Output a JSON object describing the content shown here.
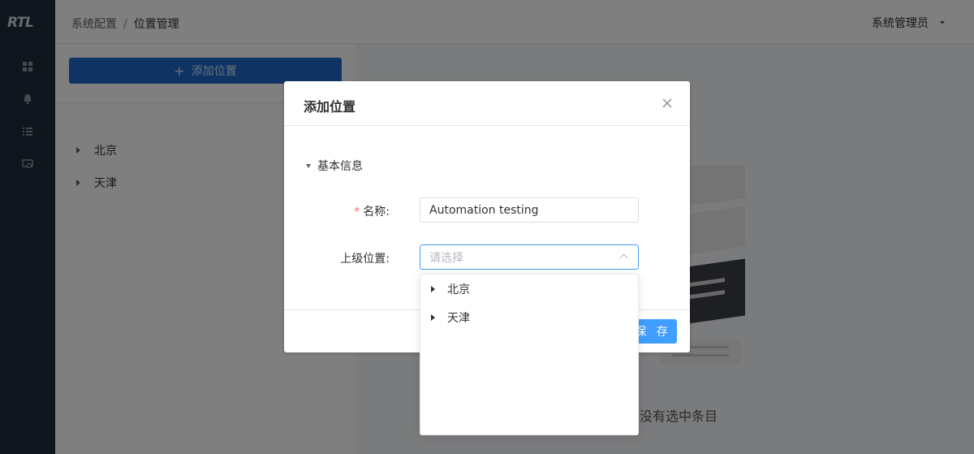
{
  "app": {
    "logo": "RTL"
  },
  "sidebar": {
    "icons": [
      "dashboard-icon",
      "bell-icon",
      "list-icon",
      "settings-monitor-icon"
    ]
  },
  "header": {
    "breadcrumb": [
      "系统配置",
      "位置管理"
    ],
    "breadcrumb_separator": "/",
    "user": "系统管理员"
  },
  "left_panel": {
    "add_button": "添加位置",
    "tree": [
      {
        "label": "北京"
      },
      {
        "label": "天津"
      }
    ]
  },
  "right_panel": {
    "empty_text": "没有选中条目"
  },
  "dialog": {
    "title": "添加位置",
    "section_title": "基本信息",
    "fields": {
      "name_label": "名称:",
      "name_value": "Automation testing",
      "parent_label": "上级位置:",
      "parent_placeholder": "请选择"
    },
    "save_button": "保 存"
  },
  "dropdown": {
    "options": [
      {
        "label": "北京"
      },
      {
        "label": "天津"
      }
    ]
  },
  "colors": {
    "sidebar": "#1f2d3d",
    "primary": "#409eff",
    "required": "#f56c6c"
  }
}
